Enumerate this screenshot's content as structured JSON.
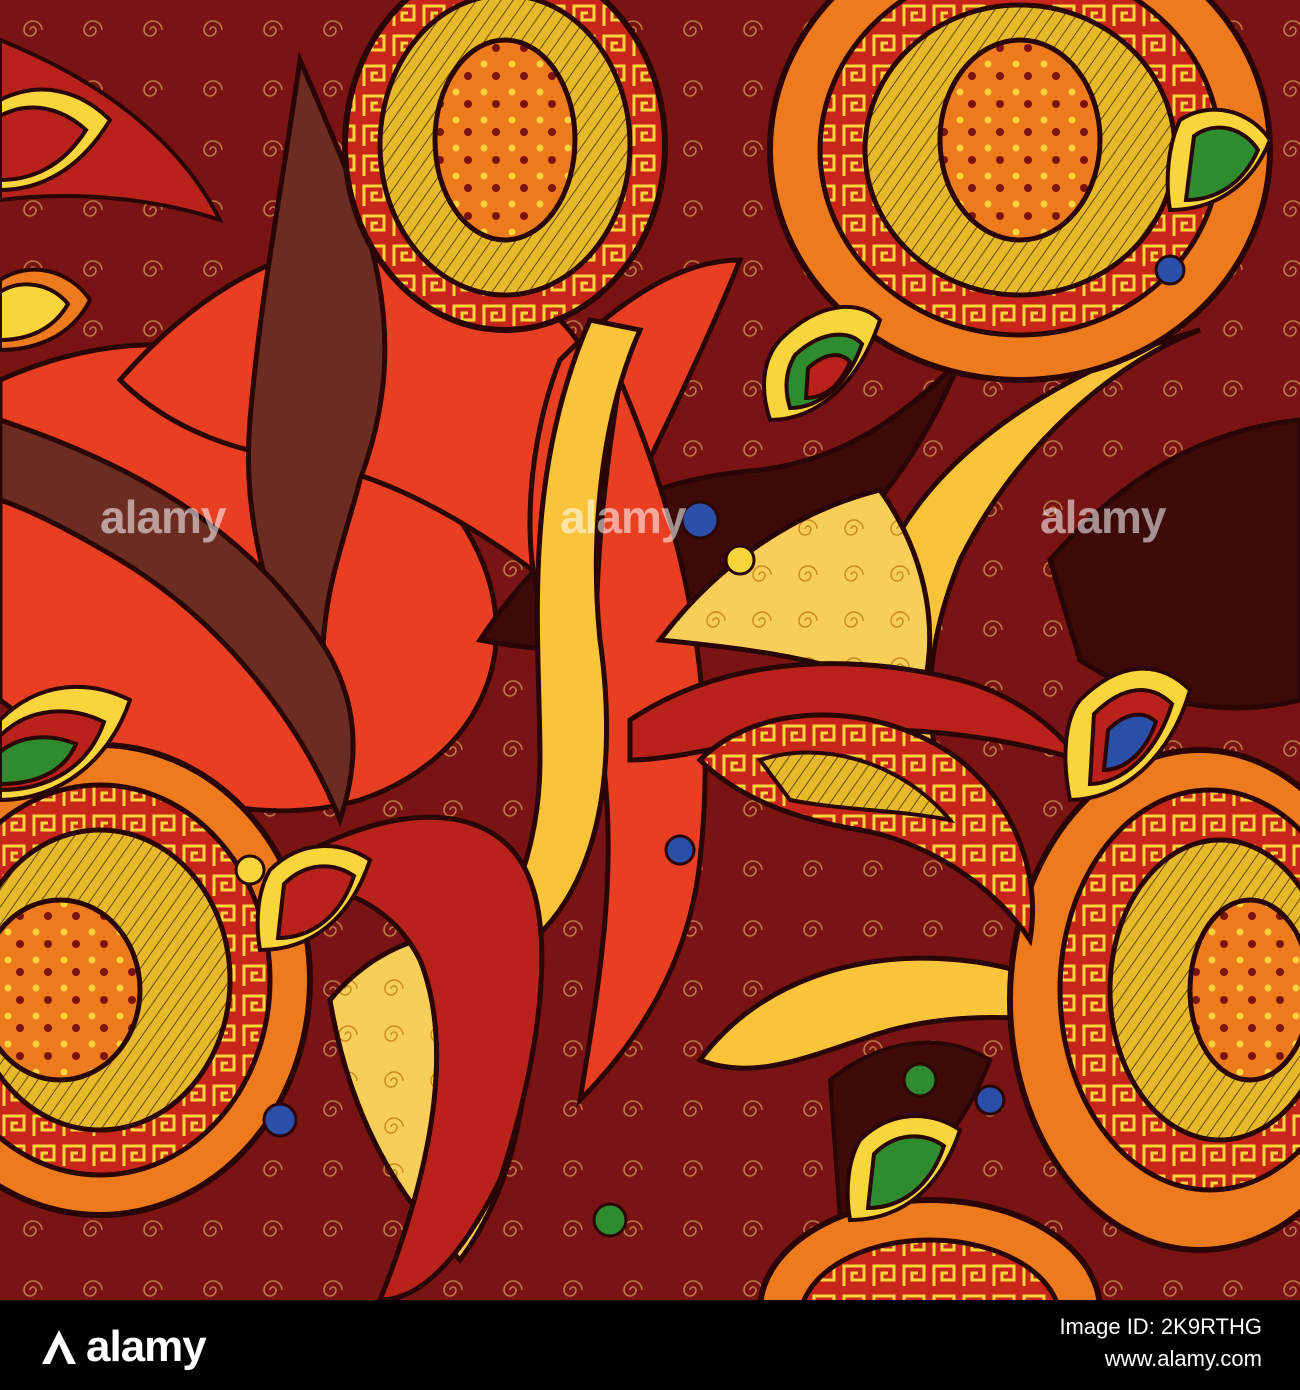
{
  "watermark": {
    "text": "alamy"
  },
  "footer": {
    "logo_text": "alamy",
    "image_id_label": "Image ID: ",
    "image_id": "2K9RTHG",
    "site": "www.alamy.com"
  },
  "colors": {
    "deep_maroon": "#3d0a0a",
    "maroon": "#7a1414",
    "red": "#b8221a",
    "vermilion": "#e83e22",
    "orange": "#ee7a1e",
    "amber": "#f5a623",
    "yellow": "#f9d53c",
    "brown": "#6b2c22",
    "green": "#2e8b2e",
    "blue": "#2a4fa8",
    "outline": "#2a0505"
  },
  "icons": {
    "footer_logo": "alamy-logo-mark"
  }
}
